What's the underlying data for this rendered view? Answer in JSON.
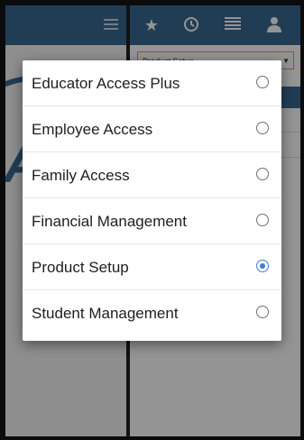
{
  "background": {
    "product_select": "Product Setup",
    "topbar_icons": [
      "menu-icon",
      "star-icon",
      "clock-icon",
      "list-icon",
      "user-icon"
    ]
  },
  "dialog": {
    "options": [
      {
        "label": "Educator Access Plus",
        "selected": false
      },
      {
        "label": "Employee Access",
        "selected": false
      },
      {
        "label": "Family Access",
        "selected": false
      },
      {
        "label": "Financial Management",
        "selected": false
      },
      {
        "label": "Product Setup",
        "selected": true
      },
      {
        "label": "Student Management",
        "selected": false
      }
    ]
  },
  "colors": {
    "topbar": "#3a6a95",
    "radio_selected": "#3d7ddb",
    "select_border": "#d8a640"
  }
}
